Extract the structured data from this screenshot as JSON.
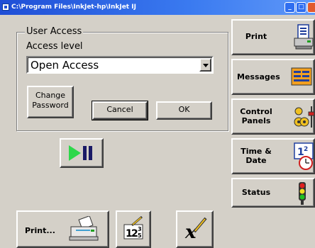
{
  "window": {
    "title": "C:\\Program Files\\InkJet-hp\\InkJet   IJ"
  },
  "access": {
    "group_title": "User Access",
    "level_label": "Access level",
    "selected_level": "Open Access"
  },
  "buttons": {
    "change_password": "Change\nPassword",
    "cancel": "Cancel",
    "ok": "OK"
  },
  "side_menu": [
    {
      "label": "Print",
      "icon": "printer-document-icon"
    },
    {
      "label": "Messages",
      "icon": "messages-icon"
    },
    {
      "label": "Control\nPanels",
      "icon": "control-panels-icon"
    },
    {
      "label": "Time &\nDate",
      "icon": "calendar-clock-icon"
    },
    {
      "label": "Status",
      "icon": "status-light-icon"
    }
  ],
  "bottom_bar": {
    "print_label": "Print..."
  },
  "colors": {
    "title_bar": "#1f4ed6",
    "play_green": "#2dd84a",
    "status_red": "#e02020",
    "status_yellow": "#f0e020",
    "status_green": "#20c020"
  }
}
